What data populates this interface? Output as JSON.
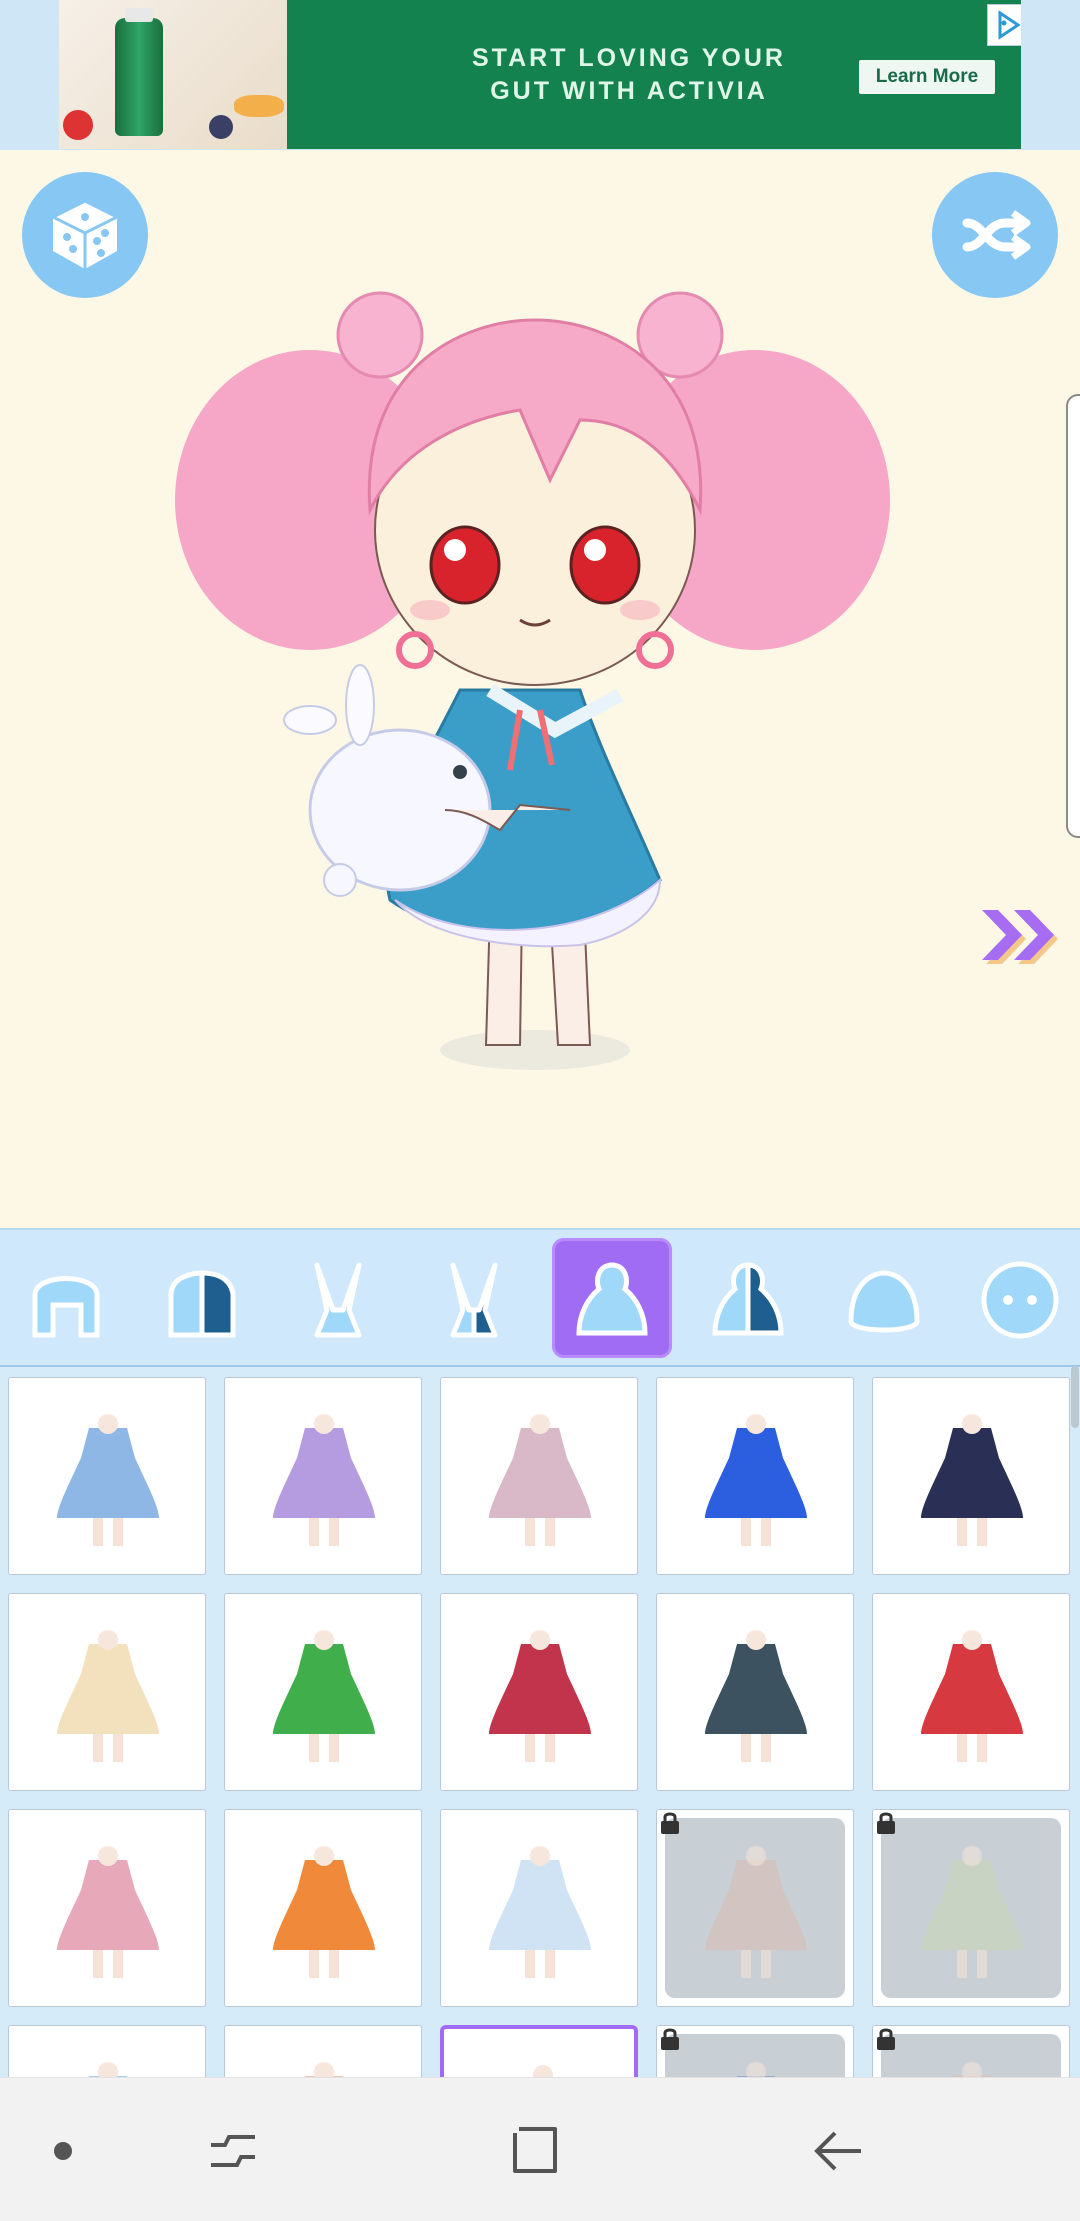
{
  "ad": {
    "headline_line1": "START LOVING YOUR",
    "headline_line2": "GUT WITH ACTIVIA",
    "cta_label": "Learn More",
    "brand_color": "#14824f"
  },
  "stage": {
    "background": "#fdf8e6",
    "left_button_icon": "dice-icon",
    "right_button_icon": "shuffle-icon",
    "next_icon": "double-chevron-right-icon"
  },
  "categories": [
    {
      "name": "hair-front",
      "active": false
    },
    {
      "name": "hair-front-alt",
      "active": false
    },
    {
      "name": "hair-back",
      "active": false
    },
    {
      "name": "hair-back-alt",
      "active": false
    },
    {
      "name": "outfit",
      "active": true
    },
    {
      "name": "outfit-alt",
      "active": false
    },
    {
      "name": "body",
      "active": false
    },
    {
      "name": "face",
      "active": false
    }
  ],
  "outfits": [
    {
      "color": "#8fb7e6",
      "locked": false,
      "selected": false
    },
    {
      "color": "#b59be0",
      "locked": false,
      "selected": false
    },
    {
      "color": "#d9b8c8",
      "locked": false,
      "selected": false
    },
    {
      "color": "#2b5fe0",
      "locked": false,
      "selected": false
    },
    {
      "color": "#2a2f55",
      "locked": false,
      "selected": false
    },
    {
      "color": "#f2e1bc",
      "locked": false,
      "selected": false
    },
    {
      "color": "#3fae4b",
      "locked": false,
      "selected": false
    },
    {
      "color": "#c2344b",
      "locked": false,
      "selected": false
    },
    {
      "color": "#3d5260",
      "locked": false,
      "selected": false
    },
    {
      "color": "#d6393f",
      "locked": false,
      "selected": false
    },
    {
      "color": "#e7a9b9",
      "locked": false,
      "selected": false
    },
    {
      "color": "#f08a3a",
      "locked": false,
      "selected": false
    },
    {
      "color": "#cfe3f4",
      "locked": false,
      "selected": false
    },
    {
      "color": "#d9b9b0",
      "locked": true,
      "selected": false
    },
    {
      "color": "#c9d6b5",
      "locked": true,
      "selected": false
    },
    {
      "color": "#9fd1ea",
      "locked": false,
      "selected": false
    },
    {
      "color": "#f0c7b6",
      "locked": false,
      "selected": false
    },
    {
      "color": "#bfe3f4",
      "locked": false,
      "selected": true
    },
    {
      "color": "#6a8bd1",
      "locked": true,
      "selected": false
    },
    {
      "color": "#e8b49a",
      "locked": true,
      "selected": false
    }
  ],
  "navbar": {
    "recent_icon": "dot-icon",
    "apps_icon": "recents-icon",
    "home_icon": "home-square-icon",
    "back_icon": "back-arrow-icon"
  }
}
